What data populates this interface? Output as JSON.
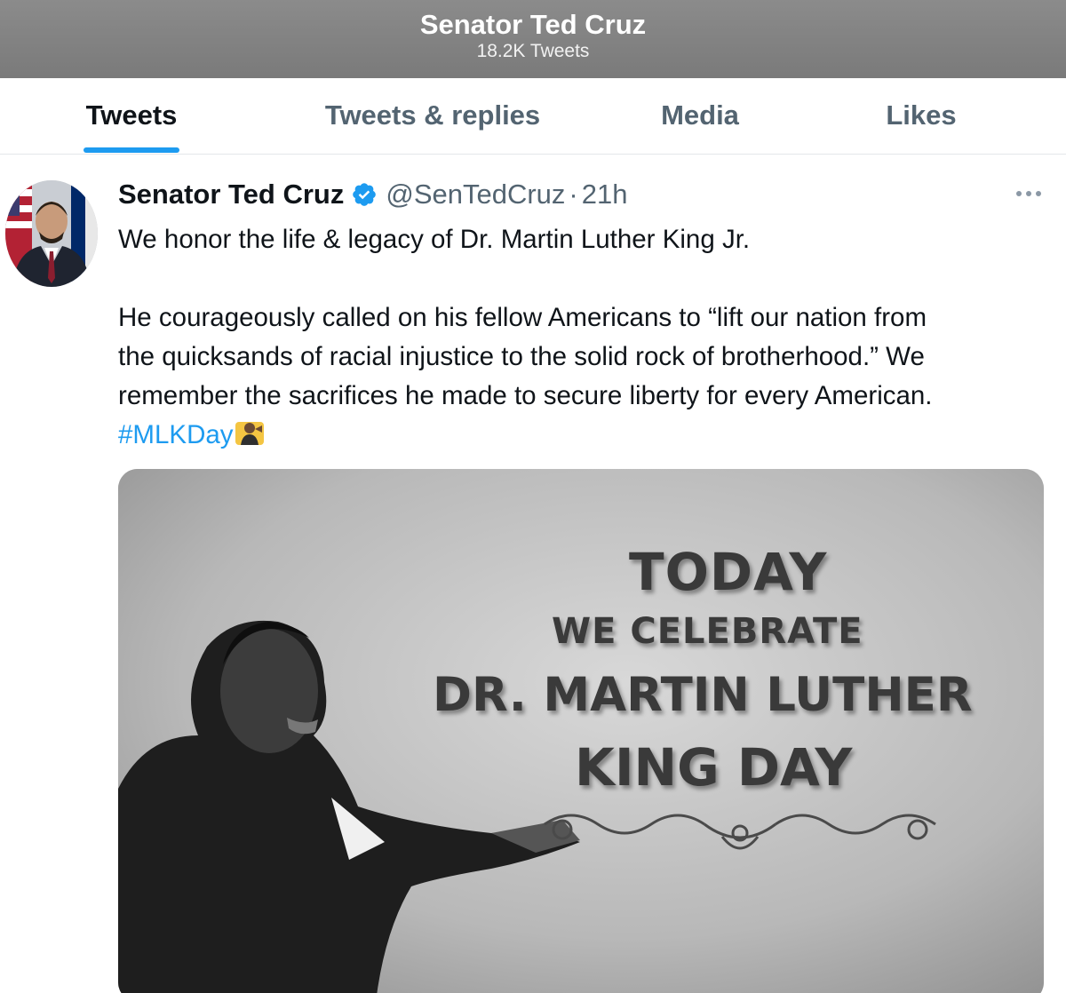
{
  "header": {
    "title": "Senator Ted Cruz",
    "subtitle": "18.2K Tweets"
  },
  "tabs": [
    {
      "label": "Tweets",
      "active": true
    },
    {
      "label": "Tweets & replies",
      "active": false
    },
    {
      "label": "Media",
      "active": false
    },
    {
      "label": "Likes",
      "active": false
    }
  ],
  "tweet": {
    "author_name": "Senator Ted Cruz",
    "verified_icon": "verified-badge-icon",
    "handle": "@SenTedCruz",
    "separator": "·",
    "time": "21h",
    "more_icon": "more-options-icon",
    "lines": [
      "We honor the life & legacy of Dr. Martin Luther King Jr.",
      "He courageously called on his fellow Americans to “lift our nation from",
      "the quicksands of racial injustice to the solid rock of brotherhood.” We",
      "remember the sacrifices he made to secure liberty for every American."
    ],
    "hashtag": "#MLKDay",
    "emoji_icon": "speaking-person-emoji-icon",
    "media": {
      "lines": [
        "TODAY",
        "WE CELEBRATE",
        "DR. MARTIN LUTHER",
        "KING DAY"
      ]
    }
  },
  "colors": {
    "accent": "#1d9bf0",
    "header_bg": "#808080",
    "secondary_text": "#536471"
  }
}
